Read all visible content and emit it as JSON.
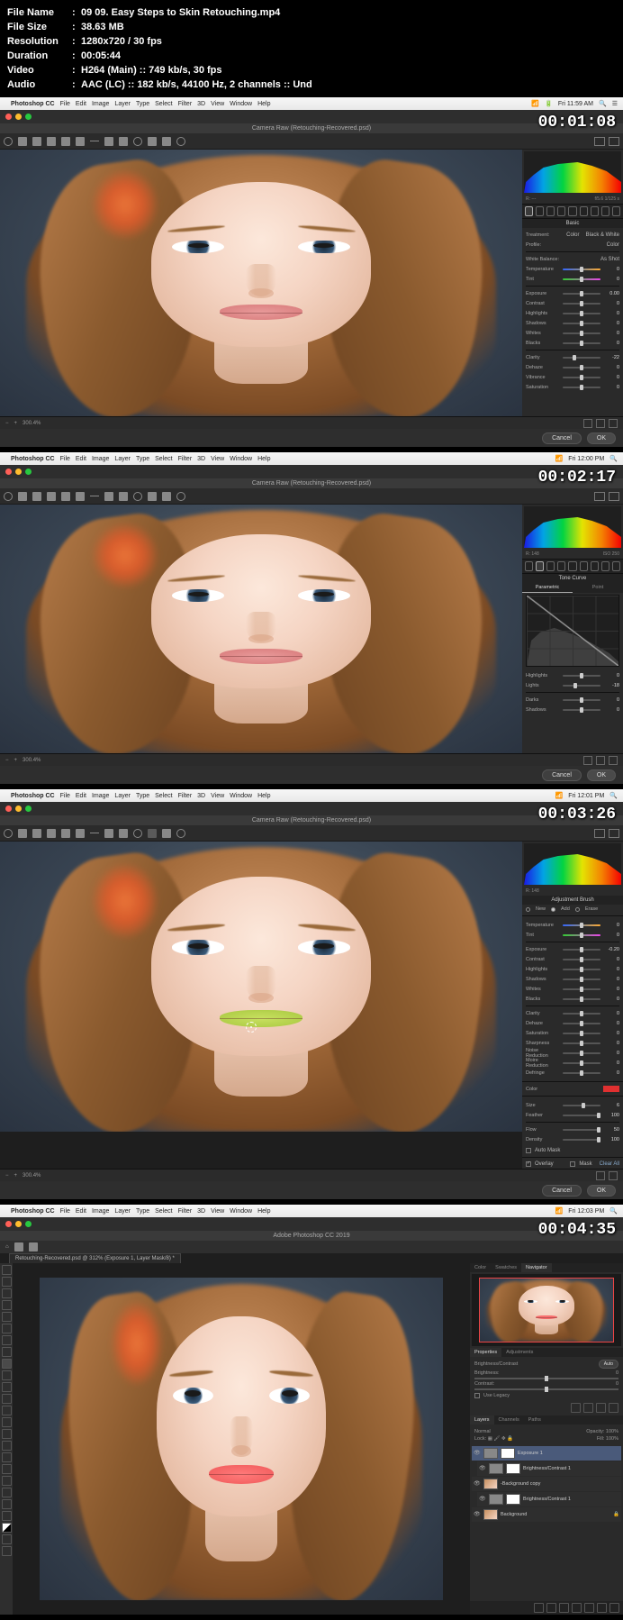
{
  "fileinfo": {
    "labels": {
      "name": "File Name",
      "size": "File Size",
      "res": "Resolution",
      "dur": "Duration",
      "vid": "Video",
      "aud": "Audio"
    },
    "name": "09 09. Easy Steps to Skin Retouching.mp4",
    "size": "38.63 MB",
    "resolution": "1280x720 / 30 fps",
    "duration": "00:05:44",
    "video": "H264 (Main) :: 749 kb/s, 30 fps",
    "audio": "AAC (LC) :: 182 kb/s, 44100 Hz, 2 channels :: Und"
  },
  "timestamps": [
    "00:01:08",
    "00:02:17",
    "00:03:26",
    "00:04:35"
  ],
  "menubar": {
    "app": "Photoshop CC",
    "items": [
      "File",
      "Edit",
      "Image",
      "Layer",
      "Type",
      "Select",
      "Filter",
      "3D",
      "View",
      "Window",
      "Help"
    ],
    "clock1": "Fri 11:59 AM",
    "clock2": "Fri 12:00 PM",
    "clock3": "Fri 12:01 PM",
    "clock4": "Fri 12:03 PM"
  },
  "doc_title": "Camera Raw (Retouching-Recovered.psd)",
  "doc_title4": "Adobe Photoshop CC 2019",
  "status": {
    "zoom": "300.4%"
  },
  "buttons": {
    "cancel": "Cancel",
    "ok": "OK"
  },
  "panel1": {
    "meta": {
      "r": "R: ---",
      "f": "f/5.6 1/125 s"
    },
    "treatment": "Treatment:",
    "color": "Color",
    "bw": "Black & White",
    "profile": "Profile:",
    "profile_val": "Color",
    "wb_label": "White Balance:",
    "wb_val": "As Shot",
    "sliders": [
      {
        "label": "Temperature",
        "val": "0"
      },
      {
        "label": "Tint",
        "val": "0"
      },
      {
        "label": "Exposure",
        "val": "0.00"
      },
      {
        "label": "Contrast",
        "val": "0"
      },
      {
        "label": "Highlights",
        "val": "0"
      },
      {
        "label": "Shadows",
        "val": "0"
      },
      {
        "label": "Whites",
        "val": "0"
      },
      {
        "label": "Blacks",
        "val": "0"
      },
      {
        "label": "Clarity",
        "val": "-22"
      },
      {
        "label": "Dehaze",
        "val": "0"
      },
      {
        "label": "Vibrance",
        "val": "0"
      },
      {
        "label": "Saturation",
        "val": "0"
      }
    ],
    "basic": "Basic"
  },
  "panel2": {
    "meta": {
      "r": "R: 148",
      "iso": "ISO 250"
    },
    "title": "Tone Curve",
    "tabs": [
      "Parametric",
      "Point"
    ],
    "sliders": [
      {
        "label": "Highlights",
        "val": "0"
      },
      {
        "label": "Lights",
        "val": "-18"
      },
      {
        "label": "Darks",
        "val": "0"
      },
      {
        "label": "Shadows",
        "val": "0"
      }
    ]
  },
  "panel3": {
    "meta": {
      "r": "R: 148"
    },
    "title": "Adjustment Brush",
    "mask_opts": [
      "New",
      "Add",
      "Erase"
    ],
    "sliders": [
      {
        "label": "Temperature",
        "val": "0"
      },
      {
        "label": "Tint",
        "val": "0"
      },
      {
        "label": "Exposure",
        "val": "-0.20"
      },
      {
        "label": "Contrast",
        "val": "0"
      },
      {
        "label": "Highlights",
        "val": "0"
      },
      {
        "label": "Shadows",
        "val": "0"
      },
      {
        "label": "Whites",
        "val": "0"
      },
      {
        "label": "Blacks",
        "val": "0"
      },
      {
        "label": "Clarity",
        "val": "0"
      },
      {
        "label": "Dehaze",
        "val": "0"
      },
      {
        "label": "Saturation",
        "val": "0"
      },
      {
        "label": "Sharpness",
        "val": "0"
      },
      {
        "label": "Noise Reduction",
        "val": "0"
      },
      {
        "label": "Moire Reduction",
        "val": "0"
      },
      {
        "label": "Defringe",
        "val": "0"
      }
    ],
    "color_label": "Color",
    "brush": [
      {
        "label": "Size",
        "val": "6"
      },
      {
        "label": "Feather",
        "val": "100"
      },
      {
        "label": "Flow",
        "val": "50"
      },
      {
        "label": "Density",
        "val": "100"
      }
    ],
    "automask": "Auto Mask",
    "overlay": "Overlay",
    "mask": "Mask",
    "clear": "Clear All"
  },
  "frame4": {
    "doc_tab": "Retouching-Recovered.psd @ 312% (Exposure 1, Layer Mask/8) *",
    "dock_tabs_nav": [
      "Color",
      "Swatches",
      "Navigator"
    ],
    "dock_tabs_prop": [
      "Properties",
      "Adjustments"
    ],
    "prop_title": "Brightness/Contrast",
    "auto": "Auto",
    "props": [
      {
        "label": "Brightness:",
        "val": "0"
      },
      {
        "label": "Contrast:",
        "val": "0"
      }
    ],
    "legacy": "Use Legacy",
    "dock_tabs_layers": [
      "Layers",
      "Channels",
      "Paths"
    ],
    "blend": "Normal",
    "opacity_lbl": "Opacity:",
    "opacity": "100%",
    "lock_lbl": "Lock:",
    "fill_lbl": "Fill:",
    "fill": "100%",
    "layers": [
      {
        "name": "Exposure 1",
        "kind": "adj"
      },
      {
        "name": "Brightness/Contrast 1",
        "kind": "adj"
      },
      {
        "name": "-Background copy",
        "kind": "img"
      },
      {
        "name": "Brightness/Contrast 1",
        "kind": "adj"
      },
      {
        "name": "Background",
        "kind": "img",
        "locked": true
      }
    ]
  }
}
